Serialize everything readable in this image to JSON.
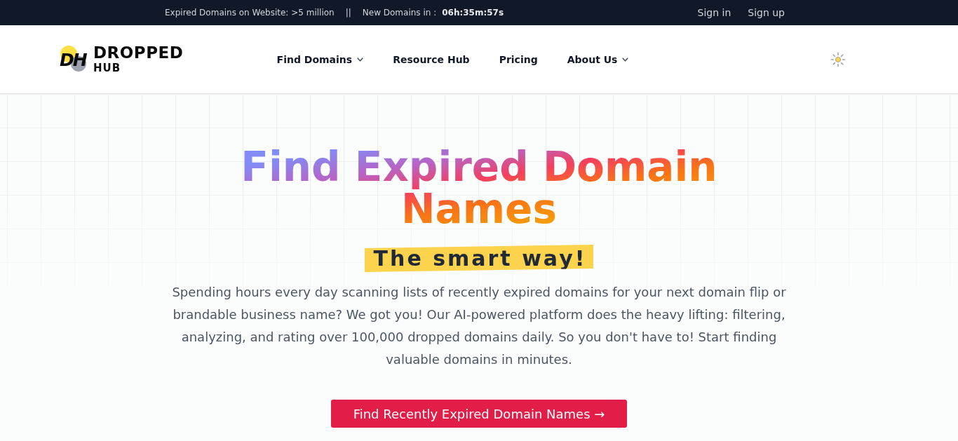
{
  "top_bar": {
    "expired_domains": "Expired Domains on Website: >5 million",
    "separator": "||",
    "countdown_label": "New Domains in :",
    "countdown": "06h:35m:57s",
    "links": [
      "Sign in",
      "Sign up"
    ]
  },
  "header": {
    "logo": {
      "initials": "DH",
      "name": "DROPPED",
      "subname": "HUB"
    },
    "nav": [
      {
        "label": "Find Domains",
        "has_menu": true
      },
      {
        "label": "Resource Hub",
        "has_menu": false
      },
      {
        "label": "Pricing",
        "has_menu": false
      },
      {
        "label": "About Us",
        "has_menu": true
      }
    ]
  },
  "hero": {
    "title": "Find Expired Domain Names",
    "tagline": "The smart way!",
    "description": "Spending hours every day scanning lists of recently expired domains for your next domain flip or brandable business name? We got you! Our AI-powered platform does the heavy lifting: filtering, analyzing, and rating over 100,000 dropped domains daily. So you don't have to! Start finding valuable domains in minutes.",
    "cta": "Find Recently Expired Domain Names →"
  }
}
